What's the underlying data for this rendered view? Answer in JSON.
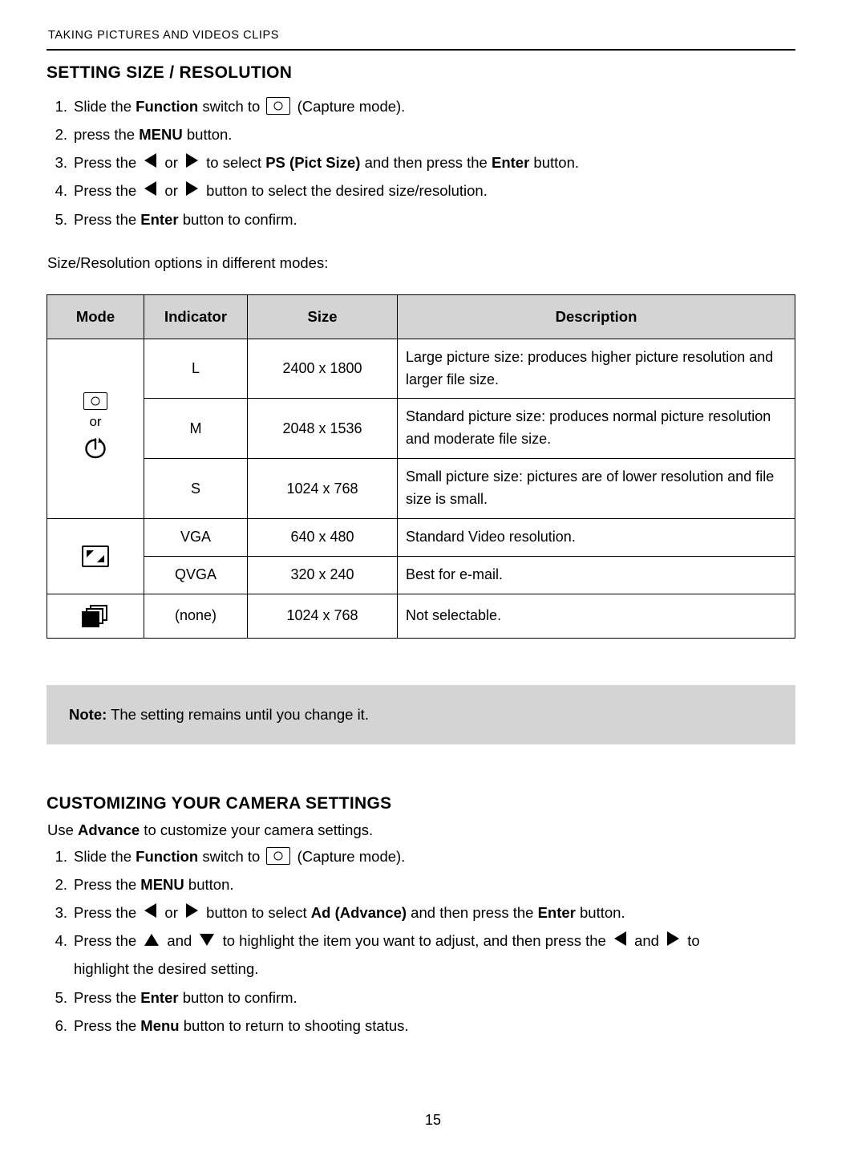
{
  "header": {
    "running_head": "TAKING PICTURES AND VIDEOS CLIPS"
  },
  "section1": {
    "title": "SETTING SIZE / RESOLUTION",
    "steps": [
      {
        "num": "1.",
        "pre": "Slide the ",
        "bold1": "Function",
        "mid": " switch to ",
        "icon": "camera-icon",
        "post": " (Capture mode)."
      },
      {
        "num": "2.",
        "pre": "press the ",
        "bold1": "MENU",
        "mid": " button.",
        "post": ""
      },
      {
        "num": "3.",
        "pre": "Press the ",
        "arrow1": "left-arrow-icon",
        "or": " or ",
        "arrow2": "right-arrow-icon",
        "mid": " to select ",
        "bold1": "PS (Pict Size)",
        "mid2": " and then press the ",
        "bold2": "Enter",
        "post": " button."
      },
      {
        "num": "4.",
        "pre": "Press the ",
        "arrow1": "left-arrow-icon",
        "or": " or ",
        "arrow2": "right-arrow-icon",
        "mid": " button to select the desired size/resolution."
      },
      {
        "num": "5.",
        "pre": "Press the ",
        "bold1": "Enter",
        "post": " button to confirm."
      }
    ],
    "intro_table": "Size/Resolution options in different modes:"
  },
  "table": {
    "headers": [
      "Mode",
      "Indicator",
      "Size",
      "Description"
    ],
    "mode_groups": [
      {
        "icons": [
          "camera-icon",
          "self-timer-icon"
        ],
        "or_label": "or"
      },
      {
        "icons": [
          "video-icon"
        ],
        "or_label": ""
      },
      {
        "icons": [
          "burst-icon"
        ],
        "or_label": ""
      }
    ],
    "rows": [
      {
        "indicator": "L",
        "size": "2400 x 1800",
        "description": "Large picture size: produces higher picture resolution and larger file size."
      },
      {
        "indicator": "M",
        "size": "2048 x 1536",
        "description": "Standard picture size: produces normal picture resolution and moderate file size."
      },
      {
        "indicator": "S",
        "size": "1024 x 768",
        "description": "Small picture size: pictures are of lower resolution and file size is small."
      },
      {
        "indicator": "VGA",
        "size": "640 x 480",
        "description": "Standard Video resolution."
      },
      {
        "indicator": "QVGA",
        "size": "320 x 240",
        "description": "Best for e-mail."
      },
      {
        "indicator": "(none)",
        "size": "1024 x 768",
        "description": "Not selectable."
      }
    ]
  },
  "note": {
    "label": "Note:",
    "text": " The setting remains until you change it."
  },
  "section2": {
    "title": "CUSTOMIZING YOUR CAMERA SETTINGS",
    "lead_pre": "Use ",
    "lead_bold": "Advance",
    "lead_post": " to customize your camera settings.",
    "steps": [
      {
        "num": "1.",
        "pre": "Slide the ",
        "bold1": "Function",
        "mid": " switch to ",
        "icon": "camera-icon",
        "post": " (Capture mode)."
      },
      {
        "num": "2.",
        "pre": "Press the ",
        "bold1": "MENU",
        "post": " button."
      },
      {
        "num": "3.",
        "pre": "Press the ",
        "arrow1": "left-arrow-icon",
        "or": " or ",
        "arrow2": "right-arrow-icon",
        "mid": " button to select ",
        "bold1": "Ad (Advance)",
        "mid2": " and then press the ",
        "bold2": "Enter",
        "post": " button."
      },
      {
        "num": "4.",
        "pre": "Press the ",
        "arrow1": "up-arrow-icon",
        "and": " and ",
        "arrow2": "down-arrow-icon",
        "mid": " to highlight the item you want to adjust, and then press the ",
        "arrow3": "left-arrow-icon",
        "and2": " and ",
        "arrow4": "right-arrow-icon",
        "post": " to",
        "line2": "highlight the desired setting."
      },
      {
        "num": "5.",
        "pre": "Press the ",
        "bold1": "Enter",
        "post": " button to confirm."
      },
      {
        "num": "6.",
        "pre": "Press the ",
        "bold1": "Menu",
        "post": " button to return to shooting status."
      }
    ]
  },
  "footer": {
    "page_number": "15"
  }
}
